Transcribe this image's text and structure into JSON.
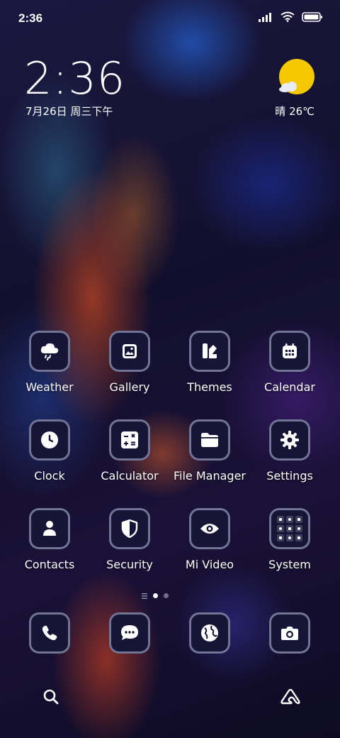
{
  "status_bar": {
    "time": "2:36",
    "icons": [
      "signal-icon",
      "wifi-icon",
      "battery-icon"
    ]
  },
  "clock_widget": {
    "time": "2:36",
    "date": "7月26日 周三下午"
  },
  "weather_widget": {
    "icon": "sun-cloud-icon",
    "text": "晴 26℃"
  },
  "apps": [
    {
      "label": "Weather",
      "icon": "cloud-rain-icon"
    },
    {
      "label": "Gallery",
      "icon": "image-icon"
    },
    {
      "label": "Themes",
      "icon": "themes-icon"
    },
    {
      "label": "Calendar",
      "icon": "calendar-icon"
    },
    {
      "label": "Clock",
      "icon": "clock-icon"
    },
    {
      "label": "Calculator",
      "icon": "calculator-icon"
    },
    {
      "label": "File Manager",
      "icon": "folder-icon"
    },
    {
      "label": "Settings",
      "icon": "gear-icon"
    },
    {
      "label": "Contacts",
      "icon": "person-icon"
    },
    {
      "label": "Security",
      "icon": "shield-icon"
    },
    {
      "label": "Mi Video",
      "icon": "eye-icon"
    },
    {
      "label": "System",
      "icon": "folder-grid-icon"
    }
  ],
  "dock": [
    {
      "icon": "phone-icon"
    },
    {
      "icon": "message-icon"
    },
    {
      "icon": "globe-icon"
    },
    {
      "icon": "camera-icon"
    }
  ],
  "bottom_bar": {
    "left_icon": "search-icon",
    "right_icon": "assistant-icon"
  },
  "colors": {
    "tile_background": "#161538",
    "tile_border": "#bec3e1",
    "sun": "#f6c800"
  }
}
